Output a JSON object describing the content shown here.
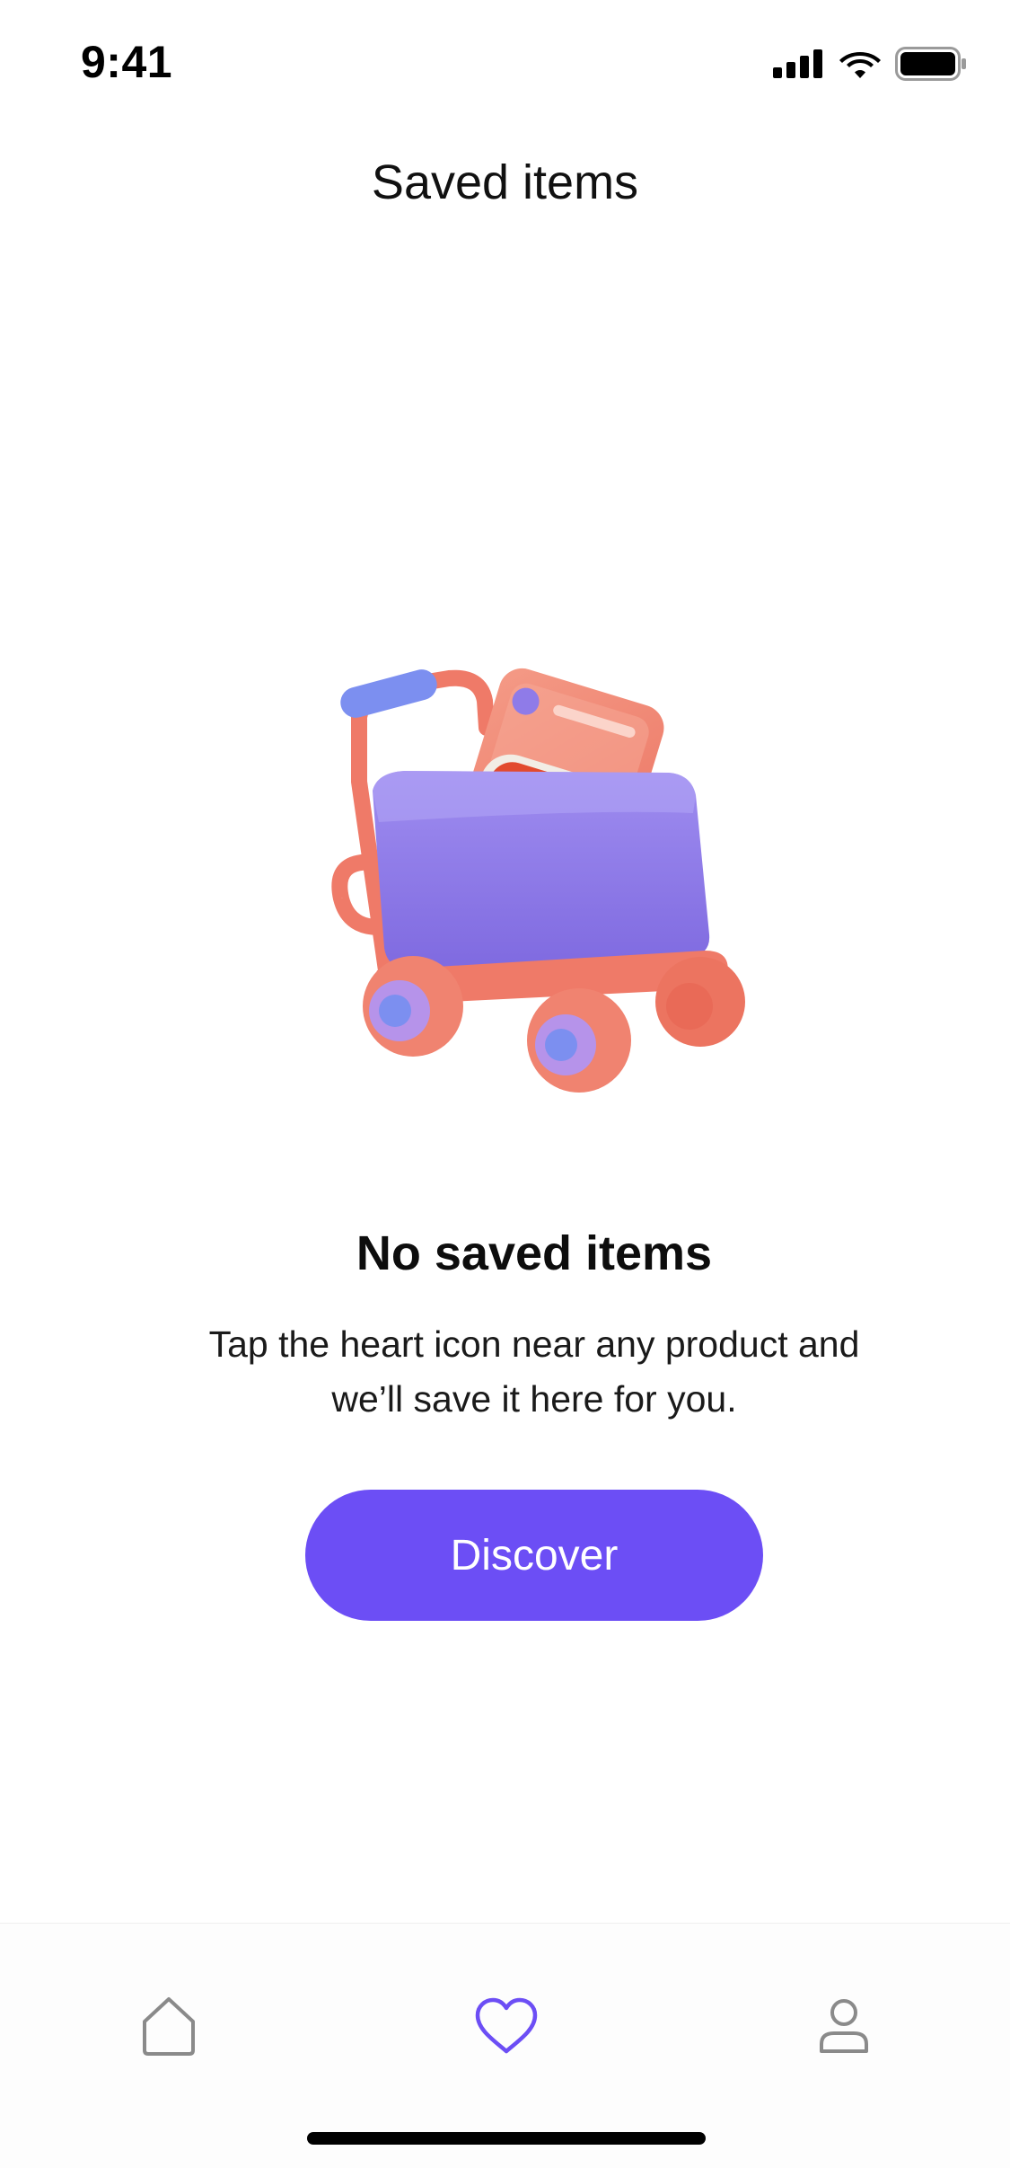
{
  "status_bar": {
    "time": "9:41"
  },
  "header": {
    "title": "Saved items"
  },
  "empty_state": {
    "illustration": "shopping-cart-illustration",
    "title": "No saved items",
    "message": "Tap the heart icon near any product and we’ll save it here for you.",
    "button_label": "Discover"
  },
  "tab_bar": {
    "items": [
      {
        "icon": "home-icon",
        "active": false
      },
      {
        "icon": "heart-icon",
        "active": true
      },
      {
        "icon": "user-icon",
        "active": false
      }
    ],
    "active_color": "#6c4ef5",
    "inactive_color": "#8a8a8a"
  },
  "colors": {
    "accent": "#6c4ef5",
    "cart_frame": "#f07a6a",
    "cart_basket": "#8f7be8"
  }
}
